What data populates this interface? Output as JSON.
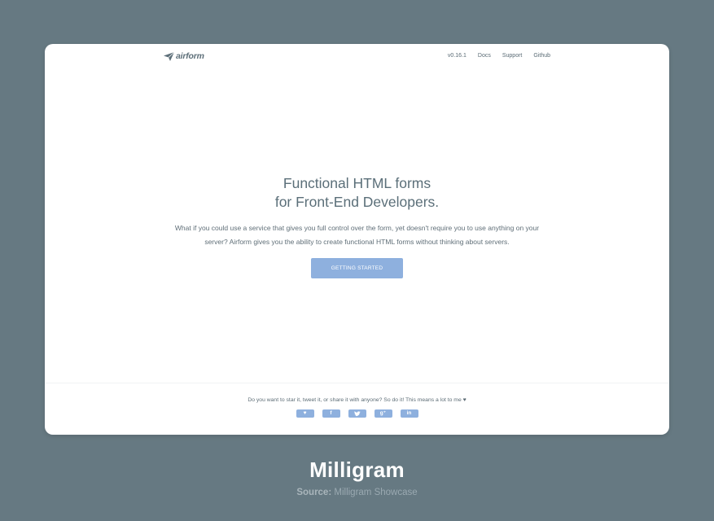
{
  "header": {
    "brand": "airform",
    "nav": [
      "v0.16.1",
      "Docs",
      "Support",
      "Github"
    ]
  },
  "hero": {
    "title_line1": "Functional HTML forms",
    "title_line2": "for Front-End Developers.",
    "desc_line1": "What if you could use a service that gives you full control over the form, yet doesn't require you to use anything on your",
    "desc_line2": "server? Airform gives you the ability to create functional HTML forms without thinking about servers.",
    "cta": "GETTING STARTED"
  },
  "footer": {
    "text": "Do you want to star it, tweet it, or share it with anyone? So do it! This means a lot to me ♥",
    "share": [
      {
        "icon": "heart-icon",
        "glyph": "♥"
      },
      {
        "icon": "facebook-icon",
        "glyph": "f"
      },
      {
        "icon": "twitter-icon",
        "glyph": "🐦"
      },
      {
        "icon": "google-plus-icon",
        "glyph": "g⁺"
      },
      {
        "icon": "linkedin-icon",
        "glyph": "in"
      }
    ]
  },
  "caption": {
    "title": "Milligram",
    "source_label": "Source:",
    "source_text": "Milligram Showcase"
  },
  "colors": {
    "background": "#667982",
    "accent": "#8eb0de",
    "text": "#5b6f79"
  }
}
